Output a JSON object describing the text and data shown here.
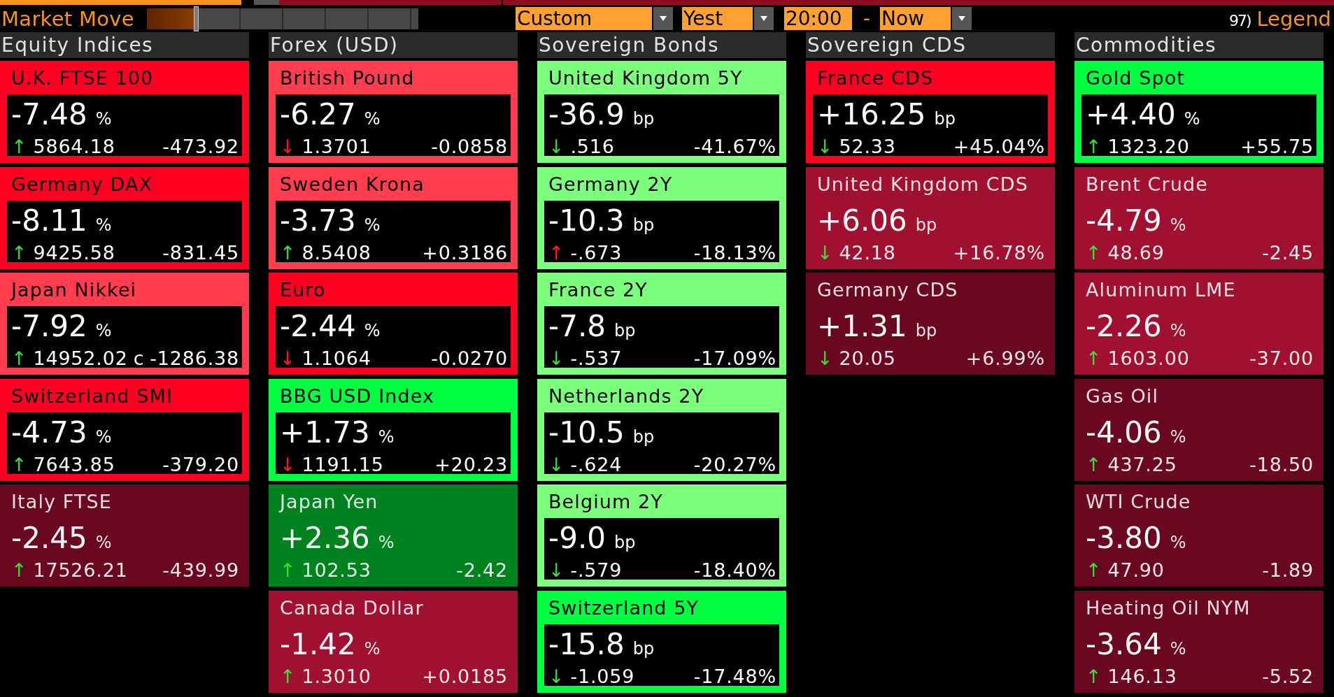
{
  "toolbar": {
    "title": "Market Move",
    "slider": {
      "level": 0.18
    },
    "period": {
      "value": "Custom"
    },
    "start_day": {
      "value": "Yest"
    },
    "start_time": {
      "value": "20:00"
    },
    "separator": "-",
    "end": {
      "value": "Now"
    },
    "legend": {
      "number": "97)",
      "label": "Legend"
    }
  },
  "groups": [
    {
      "title": "Equity Indices",
      "cards": [
        {
          "name": "U.K. FTSE 100",
          "color": "#ff0022",
          "highlighted": true,
          "change": "-7.48",
          "unit": "%",
          "trend": {
            "arrow": "↑",
            "color": "#3ddc3d"
          },
          "price": "5864.18",
          "net": "-473.92"
        },
        {
          "name": "Germany DAX",
          "color": "#ff0022",
          "highlighted": true,
          "change": "-8.11",
          "unit": "%",
          "trend": {
            "arrow": "↑",
            "color": "#3ddc3d"
          },
          "price": "9425.58",
          "net": "-831.45"
        },
        {
          "name": "Japan Nikkei",
          "color": "#ff3d4f",
          "highlighted": true,
          "change": "-7.92",
          "unit": "%",
          "trend": {
            "arrow": "↑",
            "color": "#3ddc3d"
          },
          "price": "14952.02",
          "flag": "c",
          "net": "-1286.38"
        },
        {
          "name": "Switzerland SMI",
          "color": "#ff0022",
          "highlighted": true,
          "change": "-4.73",
          "unit": "%",
          "trend": {
            "arrow": "↑",
            "color": "#3ddc3d"
          },
          "price": "7643.85",
          "net": "-379.20"
        },
        {
          "name": "Italy FTSE",
          "color": "#6a0822",
          "highlighted": false,
          "change": "-2.45",
          "unit": "%",
          "trend": {
            "arrow": "↑",
            "color": "#3ddc3d"
          },
          "price": "17526.21",
          "net": "-439.99"
        }
      ]
    },
    {
      "title": "Forex (USD)",
      "cards": [
        {
          "name": "British Pound",
          "color": "#ff3d4f",
          "highlighted": true,
          "change": "-6.27",
          "unit": "%",
          "trend": {
            "arrow": "↓",
            "color": "#ff1a1a"
          },
          "price": "1.3701",
          "net": "-0.0858"
        },
        {
          "name": "Sweden Krona",
          "color": "#ff3d4f",
          "highlighted": true,
          "change": "-3.73",
          "unit": "%",
          "trend": {
            "arrow": "↑",
            "color": "#3ddc3d"
          },
          "price": "8.5408",
          "net": "+0.3186"
        },
        {
          "name": "Euro",
          "color": "#ff0022",
          "highlighted": true,
          "change": "-2.44",
          "unit": "%",
          "trend": {
            "arrow": "↓",
            "color": "#ff1a1a"
          },
          "price": "1.1064",
          "net": "-0.0270"
        },
        {
          "name": "BBG USD Index",
          "color": "#00ff40",
          "highlighted": true,
          "change": "+1.73",
          "unit": "%",
          "trend": {
            "arrow": "↓",
            "color": "#ff1a1a"
          },
          "price": "1191.15",
          "net": "+20.23"
        },
        {
          "name": "Japan Yen",
          "color": "#00821e",
          "highlighted": false,
          "change": "+2.36",
          "unit": "%",
          "trend": {
            "arrow": "↑",
            "color": "#3ddc3d"
          },
          "price": "102.53",
          "net": "-2.42"
        },
        {
          "name": "Canada Dollar",
          "color": "#a01030",
          "highlighted": false,
          "change": "-1.42",
          "unit": "%",
          "trend": {
            "arrow": "↑",
            "color": "#3ddc3d"
          },
          "price": "1.3010",
          "net": "+0.0185"
        }
      ]
    },
    {
      "title": "Sovereign Bonds",
      "cards": [
        {
          "name": "United Kingdom 5Y",
          "color": "#7cff7c",
          "highlighted": true,
          "change": "-36.9",
          "unit": "bp",
          "trend": {
            "arrow": "↓",
            "color": "#3ddc3d"
          },
          "price": ".516",
          "net": "-41.67%"
        },
        {
          "name": "Germany 2Y",
          "color": "#7cff7c",
          "highlighted": true,
          "change": "-10.3",
          "unit": "bp",
          "trend": {
            "arrow": "↑",
            "color": "#ff1a1a"
          },
          "price": "-.673",
          "net": "-18.13%"
        },
        {
          "name": "France 2Y",
          "color": "#7cff7c",
          "highlighted": true,
          "change": "-7.8",
          "unit": "bp",
          "trend": {
            "arrow": "↓",
            "color": "#3ddc3d"
          },
          "price": "-.537",
          "net": "-17.09%"
        },
        {
          "name": "Netherlands 2Y",
          "color": "#7cff7c",
          "highlighted": true,
          "change": "-10.5",
          "unit": "bp",
          "trend": {
            "arrow": "↓",
            "color": "#3ddc3d"
          },
          "price": "-.624",
          "net": "-20.27%"
        },
        {
          "name": "Belgium 2Y",
          "color": "#7cff7c",
          "highlighted": true,
          "change": "-9.0",
          "unit": "bp",
          "trend": {
            "arrow": "↓",
            "color": "#3ddc3d"
          },
          "price": "-.579",
          "net": "-18.40%"
        },
        {
          "name": "Switzerland 5Y",
          "color": "#00ff40",
          "highlighted": true,
          "change": "-15.8",
          "unit": "bp",
          "trend": {
            "arrow": "↓",
            "color": "#3ddc3d"
          },
          "price": "-1.059",
          "net": "-17.48%"
        }
      ]
    },
    {
      "title": "Sovereign CDS",
      "cards": [
        {
          "name": "France CDS",
          "color": "#ff0022",
          "highlighted": true,
          "change": "+16.25",
          "unit": "bp",
          "trend": {
            "arrow": "↓",
            "color": "#3ddc3d"
          },
          "price": "52.33",
          "net": "+45.04%"
        },
        {
          "name": "United Kingdom CDS",
          "color": "#a01030",
          "highlighted": false,
          "change": "+6.06",
          "unit": "bp",
          "trend": {
            "arrow": "↓",
            "color": "#3ddc3d"
          },
          "price": "42.18",
          "net": "+16.78%"
        },
        {
          "name": "Germany CDS",
          "color": "#6a0822",
          "highlighted": false,
          "change": "+1.31",
          "unit": "bp",
          "trend": {
            "arrow": "↓",
            "color": "#3ddc3d"
          },
          "price": "20.05",
          "net": "+6.99%"
        }
      ]
    },
    {
      "title": "Commodities",
      "cards": [
        {
          "name": "Gold Spot",
          "color": "#00ff40",
          "highlighted": true,
          "change": "+4.40",
          "unit": "%",
          "trend": {
            "arrow": "↑",
            "color": "#3ddc3d"
          },
          "price": "1323.20",
          "net": "+55.75"
        },
        {
          "name": "Brent Crude",
          "color": "#a01030",
          "highlighted": false,
          "change": "-4.79",
          "unit": "%",
          "trend": {
            "arrow": "↑",
            "color": "#3ddc3d"
          },
          "price": "48.69",
          "net": "-2.45"
        },
        {
          "name": "Aluminum LME",
          "color": "#a01030",
          "highlighted": false,
          "change": "-2.26",
          "unit": "%",
          "trend": {
            "arrow": "↑",
            "color": "#3ddc3d"
          },
          "price": "1603.00",
          "net": "-37.00"
        },
        {
          "name": "Gas Oil",
          "color": "#6a0822",
          "highlighted": false,
          "change": "-4.06",
          "unit": "%",
          "trend": {
            "arrow": "↑",
            "color": "#3ddc3d"
          },
          "price": "437.25",
          "net": "-18.50"
        },
        {
          "name": "WTI Crude",
          "color": "#6a0822",
          "highlighted": false,
          "change": "-3.80",
          "unit": "%",
          "trend": {
            "arrow": "↑",
            "color": "#3ddc3d"
          },
          "price": "47.90",
          "net": "-1.89"
        },
        {
          "name": "Heating Oil NYM",
          "color": "#6a0822",
          "highlighted": false,
          "change": "-3.64",
          "unit": "%",
          "trend": {
            "arrow": "↑",
            "color": "#3ddc3d"
          },
          "price": "146.13",
          "net": "-5.52"
        }
      ]
    }
  ]
}
